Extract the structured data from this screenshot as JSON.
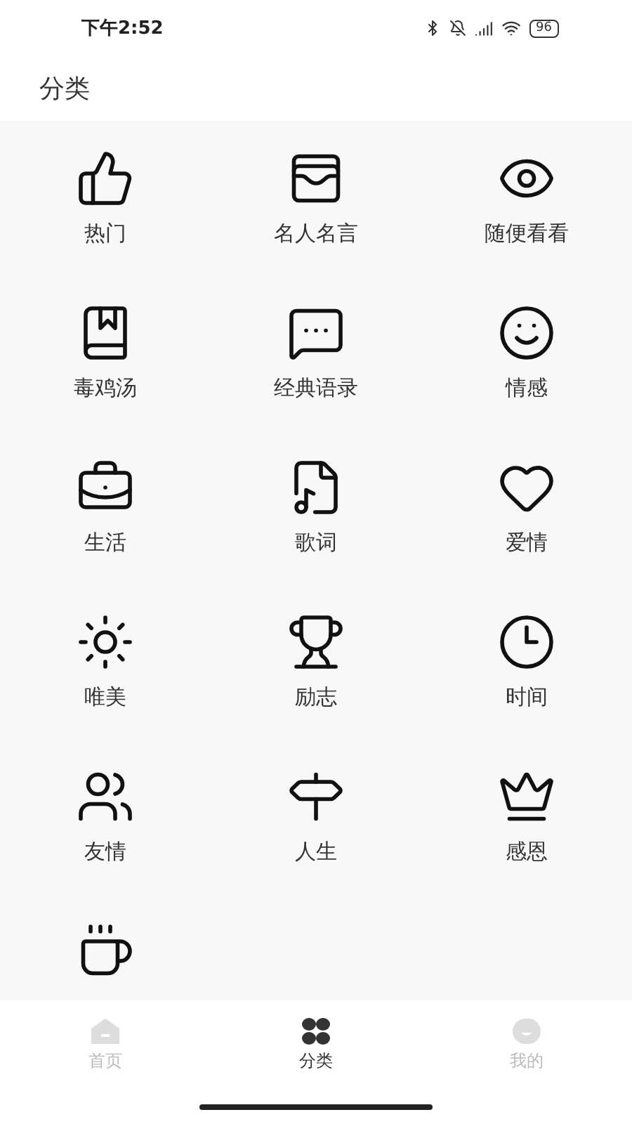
{
  "status_bar": {
    "time": "下午2:52",
    "battery": "96"
  },
  "header": {
    "title": "分类"
  },
  "categories": [
    {
      "kind": "tile",
      "label": "热门"
    },
    {
      "kind": "tile",
      "label": "名人名言"
    },
    {
      "kind": "tile",
      "label": "随便看看"
    },
    {
      "kind": "tile",
      "label": "毒鸡汤"
    },
    {
      "kind": "tile",
      "label": "经典语录"
    },
    {
      "kind": "tile",
      "label": "情感"
    },
    {
      "kind": "tile",
      "label": "生活"
    },
    {
      "kind": "tile",
      "label": "歌词"
    },
    {
      "kind": "tile",
      "label": "爱情"
    },
    {
      "kind": "tile",
      "label": "唯美"
    },
    {
      "kind": "tile",
      "label": "励志"
    },
    {
      "kind": "tile",
      "label": "时间"
    },
    {
      "kind": "tile",
      "label": "友情"
    },
    {
      "kind": "tile",
      "label": "人生"
    },
    {
      "kind": "tile",
      "label": "感恩"
    },
    {
      "kind": "cut-off"
    }
  ],
  "nav": [
    {
      "label": "首页",
      "selected": false
    },
    {
      "label": "分类",
      "selected": true
    },
    {
      "label": "我的",
      "selected": false
    }
  ]
}
